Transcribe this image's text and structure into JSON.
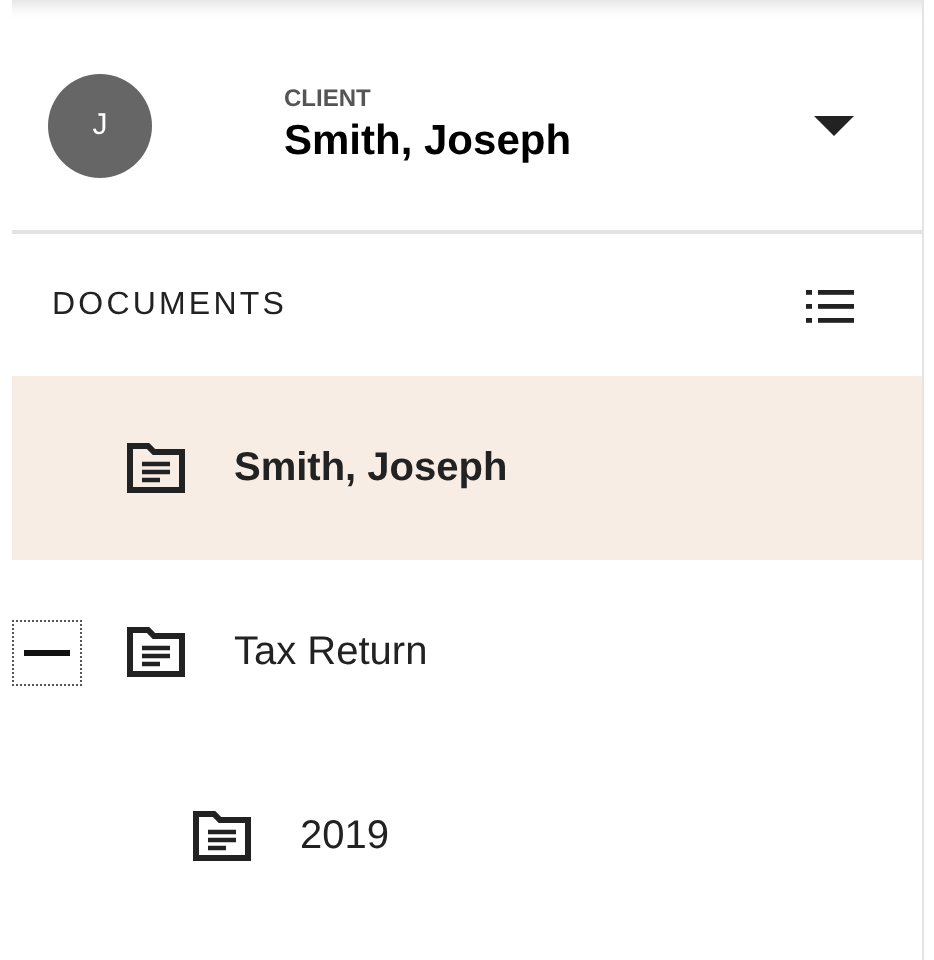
{
  "client": {
    "label": "CLIENT",
    "initial": "J",
    "name": "Smith, Joseph"
  },
  "documents": {
    "title": "DOCUMENTS",
    "items": [
      {
        "label": "Smith, Joseph",
        "selected": true
      },
      {
        "label": "Tax Return",
        "selected": false,
        "expanded": true,
        "children": [
          {
            "label": "2019",
            "selected": false
          }
        ]
      }
    ]
  }
}
